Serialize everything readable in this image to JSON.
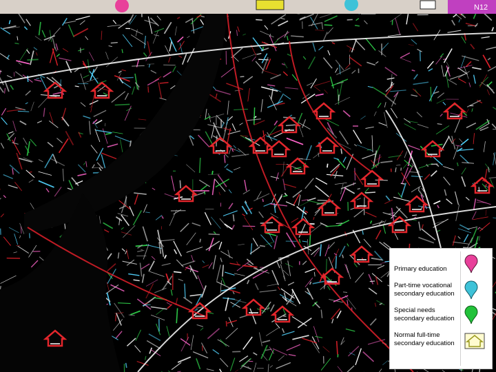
{
  "map": {
    "top_strip_labels": [
      "N12"
    ],
    "colors": {
      "background": "#000000",
      "road_main": "#ffffff",
      "road_red": "#e0202a",
      "road_cyan": "#52d4ff",
      "river": "#0a0a0a",
      "top_strip": "#d8d0c8"
    }
  },
  "markers": {
    "primary_color": "#e8409a",
    "part_time_color": "#3ec2d8",
    "special_needs_color": "#22c23a",
    "full_time_color": "#e8e030",
    "school_icon_color": "#e3262c"
  },
  "legend": {
    "items": [
      {
        "label": "Primary education",
        "icon": "pink-pin-icon"
      },
      {
        "label": "Part-time vocational secondary  education",
        "icon": "cyan-pin-icon"
      },
      {
        "label": "Special needs secondary education",
        "icon": "green-pin-icon"
      },
      {
        "label": "Normal full-time secondary education",
        "icon": "house-icon"
      }
    ]
  }
}
